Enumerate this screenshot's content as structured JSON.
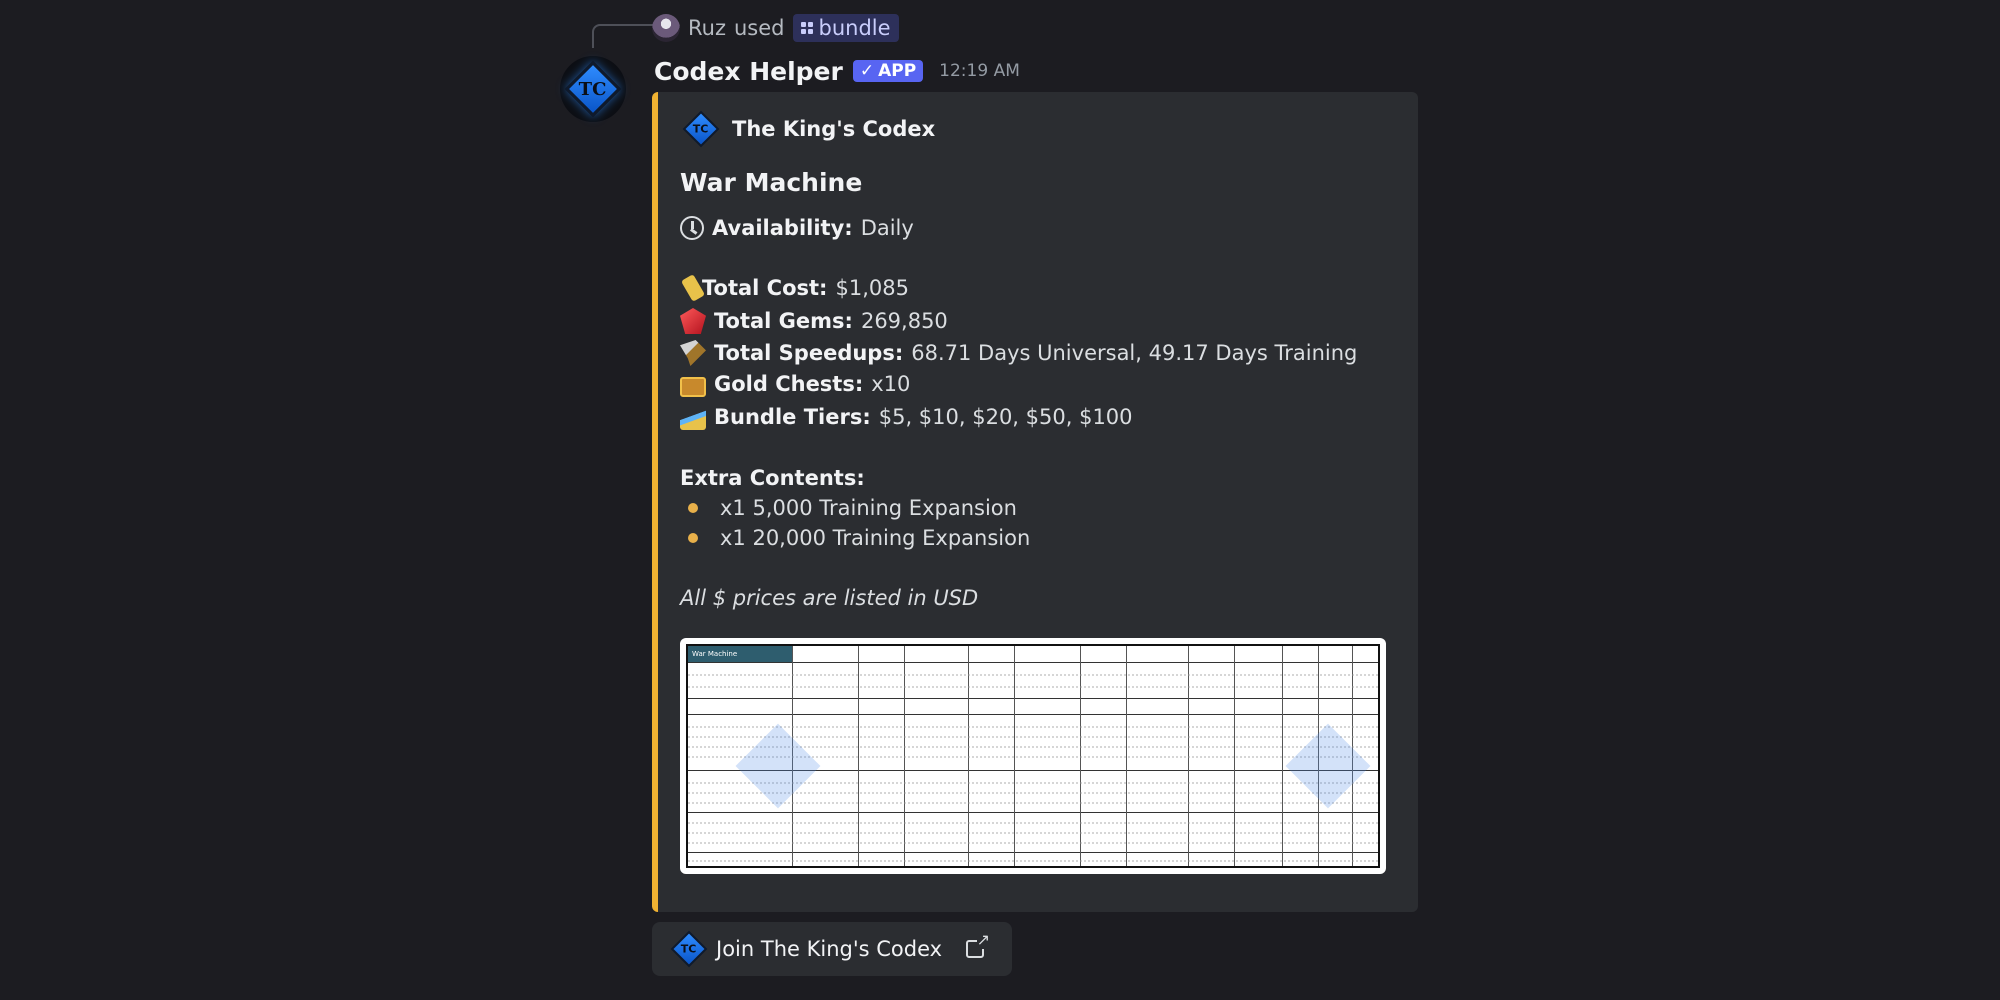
{
  "reply": {
    "user": "Ruz",
    "used_text": "used",
    "command": "bundle"
  },
  "message": {
    "username": "Codex Helper",
    "badge": "APP",
    "timestamp": "12:19 AM"
  },
  "embed": {
    "accent_color": "#f0b232",
    "author": "The King's Codex",
    "title": "War Machine",
    "availability": {
      "label": "Availability:",
      "value": "Daily",
      "icon": "clock-icon"
    },
    "stats": [
      {
        "icon": "price-tag-icon",
        "label": "Total Cost:",
        "value": "$1,085"
      },
      {
        "icon": "gem-icon",
        "label": "Total Gems:",
        "value": "269,850"
      },
      {
        "icon": "hammer-icon",
        "label": "Total Speedups:",
        "value": "68.71 Days Universal, 49.17 Days Training"
      },
      {
        "icon": "chest-icon",
        "label": "Gold Chests:",
        "value": "x10"
      },
      {
        "icon": "chart-icon",
        "label": "Bundle Tiers:",
        "value": "$5, $10, $20, $50, $100"
      }
    ],
    "extra_title": "Extra Contents:",
    "extra_items": [
      "x1 5,000 Training Expansion",
      "x1 20,000 Training Expansion"
    ],
    "footer_note": "All $ prices are listed in USD",
    "table_header": "War Machine"
  },
  "button": {
    "label": "Join The King's Codex",
    "icon": "external-link-icon"
  },
  "colors": {
    "background": "#1c1c21",
    "embed_bg": "#2b2d31",
    "brand": "#5865f2"
  }
}
